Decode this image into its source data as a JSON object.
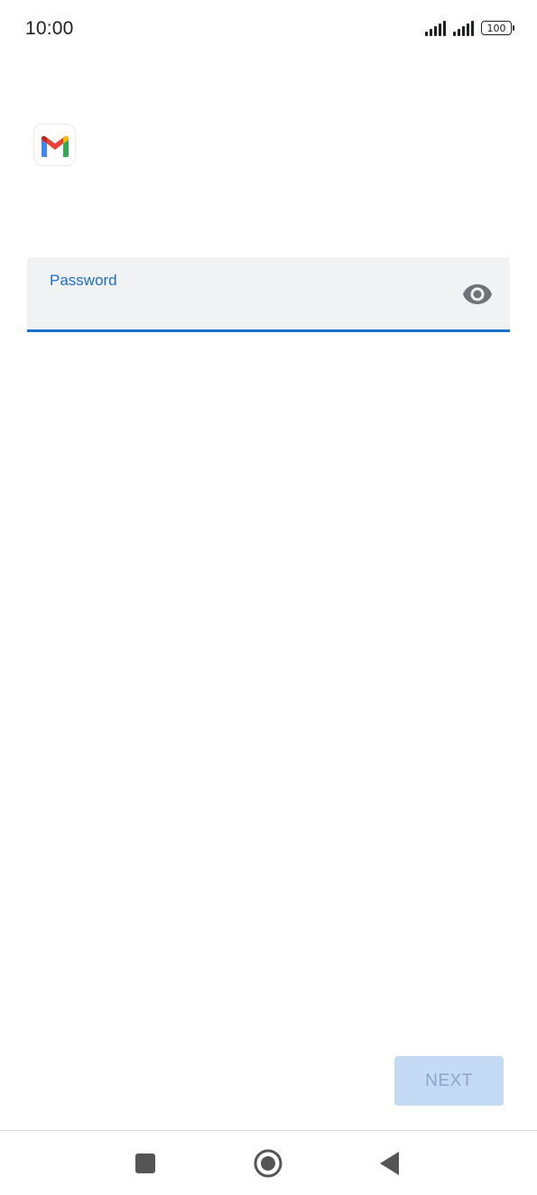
{
  "status_bar": {
    "time": "10:00",
    "battery": "100",
    "icons": [
      "signal-icon",
      "signal-icon",
      "battery-icon"
    ]
  },
  "app": {
    "logo": "gmail-logo-icon"
  },
  "password_field": {
    "label": "Password",
    "value": "",
    "placeholder": "",
    "toggle_icon": "eye-icon"
  },
  "actions": {
    "next_label": "NEXT"
  },
  "navigation": {
    "icons": [
      "recents-icon",
      "home-icon",
      "back-icon"
    ]
  },
  "colors": {
    "accent": "#1a6fcf",
    "field_background": "#f1f2f4",
    "next_disabled_bg": "#c5daf5",
    "next_disabled_text": "#8aa6c8"
  }
}
